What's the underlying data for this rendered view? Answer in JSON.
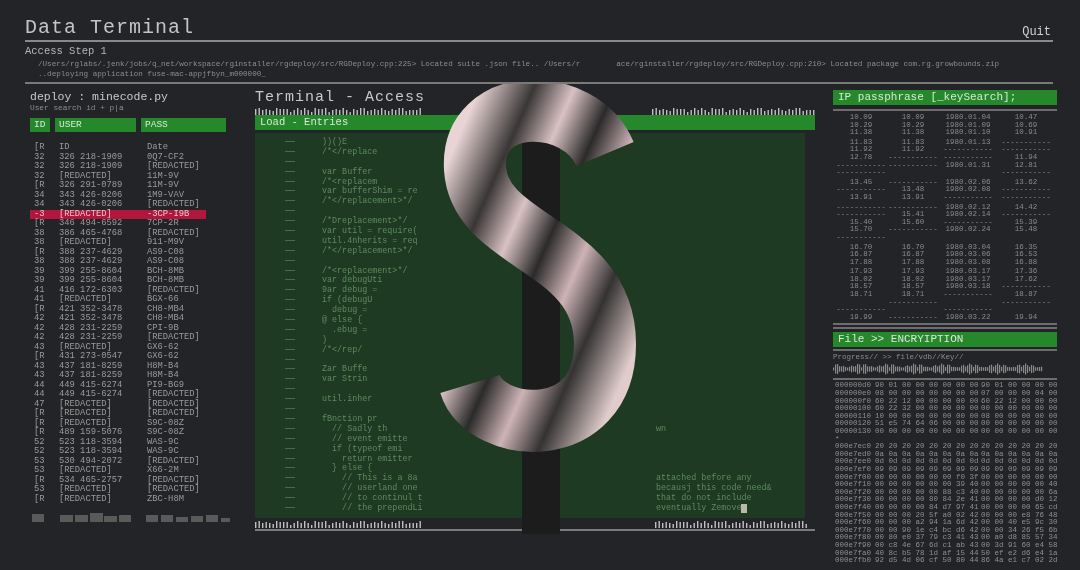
{
  "header": {
    "title": "Data Terminal",
    "quit": "Quit",
    "step": "Access Step 1",
    "log": [
      {
        "left": "/Users/rglabs/.jenk/jobs/q_net/workspace/rginstaller/rgdeploy/src/RGDeploy.cpp:225> Located suite .json file.. /Users/r",
        "right": "ace/rginstaller/rgdeploy/src/RGDeploy.cpp:210> Located package com.rg.growbounds.zip"
      },
      {
        "left": "..deploying application fuse-mac-appjfbyn_m000000_"
      }
    ]
  },
  "users": {
    "title": "deploy : minecode.py",
    "search": "User search id + p|a",
    "columns": [
      "ID",
      "USER",
      "PASS"
    ],
    "rows": [
      {
        "cells": [
          "[R",
          "ID",
          "Date"
        ],
        "selected": false
      },
      {
        "cells": [
          "32",
          "326 218-1909",
          "0Q7-CF2"
        ],
        "selected": false
      },
      {
        "cells": [
          "32",
          "326 218-1909",
          "[REDACTED]"
        ],
        "selected": false
      },
      {
        "cells": [
          "32",
          "[REDACTED]",
          "11M-9V"
        ],
        "selected": false
      },
      {
        "cells": [
          "[R",
          "326 291-0789",
          "11M-9V"
        ],
        "selected": false
      },
      {
        "cells": [
          "34",
          "343 426-0206",
          "1M9-VAV"
        ],
        "selected": false
      },
      {
        "cells": [
          "34",
          "343 426-0206",
          "[REDACTED]"
        ],
        "selected": false
      },
      {
        "cells": [
          "-3",
          "[REDACTED]",
          "-3CP-I9B"
        ],
        "selected": true
      },
      {
        "cells": [
          "[R",
          "346 494-6592",
          "7CP-2R"
        ],
        "selected": false
      },
      {
        "cells": [
          "38",
          "386 465-4768",
          "[REDACTED]"
        ],
        "selected": false
      },
      {
        "cells": [
          "38",
          "[REDACTED]",
          "911-M9V"
        ],
        "selected": false
      },
      {
        "cells": [
          "[R",
          "388 237-4629",
          "AS9-C08"
        ],
        "selected": false
      },
      {
        "cells": [
          "38",
          "388 237-4629",
          "AS9-C08"
        ],
        "selected": false
      },
      {
        "cells": [
          "39",
          "399 255-8604",
          "BCH-8MB"
        ],
        "selected": false
      },
      {
        "cells": [
          "39",
          "399 255-8604",
          "BCH-8MB"
        ],
        "selected": false
      },
      {
        "cells": [
          "41",
          "416 172-6303",
          "[REDACTED]"
        ],
        "selected": false
      },
      {
        "cells": [
          "41",
          "[REDACTED]",
          "BGX-66"
        ],
        "selected": false
      },
      {
        "cells": [
          "[R",
          "421 352-3478",
          "CH8-MB4"
        ],
        "selected": false
      },
      {
        "cells": [
          "42",
          "421 352-3478",
          "CH8-MB4"
        ],
        "selected": false
      },
      {
        "cells": [
          "42",
          "428 231-2259",
          "CPI-9B"
        ],
        "selected": false
      },
      {
        "cells": [
          "42",
          "428 231-2259",
          "[REDACTED]"
        ],
        "selected": false
      },
      {
        "cells": [
          "43",
          "[REDACTED]",
          "GX6-62"
        ],
        "selected": false
      },
      {
        "cells": [
          "[R",
          "431 273-0547",
          "GX6-62"
        ],
        "selected": false
      },
      {
        "cells": [
          "43",
          "437 181-8259",
          "H8M-B4"
        ],
        "selected": false
      },
      {
        "cells": [
          "43",
          "437 181-8259",
          "H8M-B4"
        ],
        "selected": false
      },
      {
        "cells": [
          "44",
          "449 415-6274",
          "PI9-BG9"
        ],
        "selected": false
      },
      {
        "cells": [
          "44",
          "449 415-6274",
          "[REDACTED]"
        ],
        "selected": false
      },
      {
        "cells": [
          "47",
          "[REDACTED]",
          "[REDACTED]"
        ],
        "selected": false
      },
      {
        "cells": [
          "[R",
          "[REDACTED]",
          "[REDACTED]"
        ],
        "selected": false
      },
      {
        "cells": [
          "[R",
          "[REDACTED]",
          "S9C-08Z"
        ],
        "selected": false
      },
      {
        "cells": [
          "[R",
          "489 159-5076",
          "S9C-08Z"
        ],
        "selected": false
      },
      {
        "cells": [
          "52",
          "523 118-3594",
          "WAS-9C"
        ],
        "selected": false
      },
      {
        "cells": [
          "52",
          "523 118-3594",
          "WAS-9C"
        ],
        "selected": false
      },
      {
        "cells": [
          "53",
          "530 494-2072",
          "[REDACTED]"
        ],
        "selected": false
      },
      {
        "cells": [
          "53",
          "[REDACTED]",
          "X66-2M"
        ],
        "selected": false
      },
      {
        "cells": [
          "[R",
          "534 465-2757",
          "[REDACTED]"
        ],
        "selected": false
      },
      {
        "cells": [
          "53",
          "[REDACTED]",
          "[REDACTED]"
        ],
        "selected": false
      },
      {
        "cells": [
          "[R",
          "[REDACTED]",
          "ZBC-H8M"
        ],
        "selected": false
      }
    ]
  },
  "terminal": {
    "title": "Terminal - Access",
    "bar": "Load - Entries",
    "cursor": true,
    "lines": [
      {
        "marker": "——",
        "text": "))()E"
      },
      {
        "marker": "——",
        "text": "/*</replace"
      },
      {
        "marker": "——"
      },
      {
        "marker": "——",
        "text": "var Buffer"
      },
      {
        "marker": "——",
        "text": "/*<replacem"
      },
      {
        "marker": "——",
        "text": "var bufferShim = re"
      },
      {
        "marker": "——",
        "text": "/*</replacement>*/"
      },
      {
        "marker": "——"
      },
      {
        "marker": "——",
        "text": "/*Dreplacement>*/"
      },
      {
        "marker": "——",
        "text": "var util = require("
      },
      {
        "marker": "——",
        "text": "util.4nherits = req"
      },
      {
        "marker": "——",
        "text": "/*</replacement>*/"
      },
      {
        "marker": "——"
      },
      {
        "marker": "——",
        "text": "/*<replacement>*/"
      },
      {
        "marker": "——",
        "text": "var debugUti"
      },
      {
        "marker": "——",
        "text": "9ar debug ="
      },
      {
        "marker": "——",
        "text": "if (debugU"
      },
      {
        "marker": "——",
        "text": "  debug ="
      },
      {
        "marker": "——",
        "text": "@ else {"
      },
      {
        "marker": "——",
        "text": "  .ebug ="
      },
      {
        "marker": "——",
        "text": ")"
      },
      {
        "marker": "——",
        "text": "/*</rep/"
      },
      {
        "marker": "——"
      },
      {
        "marker": "——",
        "text": "Zar Buffe"
      },
      {
        "marker": "——",
        "text": "var Strin"
      },
      {
        "marker": "——"
      },
      {
        "marker": "——",
        "text": "util.inher"
      },
      {
        "marker": "——"
      },
      {
        "marker": "——",
        "text": "fBnction pr"
      },
      {
        "marker": "——",
        "text": "  // Sadly th",
        "tail": "wn"
      },
      {
        "marker": "——",
        "text": "  // event emitte"
      },
      {
        "marker": "——",
        "text": "  if (typeof emi"
      },
      {
        "marker": "——",
        "text": "    return emitter"
      },
      {
        "marker": "——",
        "text": "  } else {"
      },
      {
        "marker": "——",
        "text": "    // This is a 8a",
        "tail": "attached before any"
      },
      {
        "marker": "——",
        "text": "    // userland one",
        "tail": "becausj this code need&"
      },
      {
        "marker": "——",
        "text": "    // to continul t",
        "tail": "that do not include"
      },
      {
        "marker": "——",
        "text": "    // the prependLi",
        "tail": "eventually Zemove"
      }
    ]
  },
  "passphrase": {
    "title": "IP passphrase [_keySearch];",
    "groups": [
      [
        {
          "c1": "10.09",
          "c2": "10.09",
          "c3": "1980.01.04",
          "c4": "10.47"
        },
        {
          "c1": "10.29",
          "c2": "10.29",
          "c3": "1980.01.09",
          "c4": "10.69"
        },
        {
          "c1": "11.38",
          "c2": "11.38",
          "c3": "1980.01.10",
          "c4": "10.91"
        }
      ],
      [
        {
          "c1": "11.83",
          "c2": "11.83",
          "c3": "1980.01.13",
          "c4": "-----------"
        },
        {
          "c1": "11.92",
          "c2": "11.92",
          "c3": "-----------",
          "c4": "-----------"
        },
        {
          "c1": "12.78",
          "c2": "-----------",
          "c3": "-----------",
          "c4": "11.94"
        },
        {
          "c1": "-----------",
          "c2": "-----------",
          "c3": "1980.01.31",
          "c4": "12.81"
        },
        {
          "c1": "-----------",
          "c4": "-----------"
        }
      ],
      [
        {
          "c1": "13.45",
          "c2": "-----------",
          "c3": "1980.02.06",
          "c4": "13.62"
        },
        {
          "c1": "-----------",
          "c2": "13.48",
          "c3": "1980.02.08",
          "c4": "-----------"
        },
        {
          "c1": "13.91",
          "c2": "13.91",
          "c3": "-----------",
          "c4": "-----------"
        }
      ],
      [
        {
          "c1": "-----------",
          "c2": "-----------",
          "c3": "1980.02.12",
          "c4": "14.42"
        },
        {
          "c1": "-----------",
          "c2": "15.41",
          "c3": "1980.02.14",
          "c4": "-----------"
        },
        {
          "c1": "15.40",
          "c2": "15.60",
          "c3": "-----------",
          "c4": "15.39"
        },
        {
          "c1": "15.70",
          "c2": "-----------",
          "c3": "1980.02.24",
          "c4": "15.48"
        },
        {
          "c1": "-----------"
        }
      ],
      [
        {
          "c1": "16.70",
          "c2": "16.70",
          "c3": "1980.03.04",
          "c4": "16.35"
        },
        {
          "c1": "16.87",
          "c2": "16.87",
          "c3": "1980.03.06",
          "c4": "16.53"
        },
        {
          "c1": "17.88",
          "c2": "17.88",
          "c3": "1980.03.08",
          "c4": "16.88"
        }
      ],
      [
        {
          "c1": "17.93",
          "c2": "17.93",
          "c3": "1980.03.17",
          "c4": "17.36"
        },
        {
          "c1": "18.02",
          "c2": "18.02",
          "c3": "1980.03.17",
          "c4": "17.62"
        },
        {
          "c1": "18.57",
          "c2": "18.57",
          "c3": "1980.03.18",
          "c4": "-----------"
        },
        {
          "c1": "18.71",
          "c2": "18.71",
          "c3": "-----------",
          "c4": "18.87"
        },
        {
          "c2": "-----------",
          "c4": "-----------"
        },
        {
          "c1": "-----------",
          "c3": "-----------"
        },
        {
          "c1": "19.99",
          "c2": "-----------",
          "c3": "1980.03.22",
          "c4": "19.94"
        }
      ]
    ]
  },
  "encryption": {
    "title": "File >> ENCRYIPTION",
    "progress": "Progress// >> file/vdb//Key//",
    "dump": [
      {
        "kind": "row",
        "addr": "000000d0",
        "a": "90 01 00 00 00 00 00 00",
        "b": "90 01 00 00 00 00"
      },
      {
        "kind": "row",
        "addr": "000000e0",
        "a": "08 00 00 00 00 00 00 00",
        "b": "07 00 00 00 04 00"
      },
      {
        "kind": "row",
        "addr": "000000f0",
        "a": "60 22 12 00 00 00 00 00",
        "b": "60 22 12 00 00 00"
      },
      {
        "kind": "row",
        "addr": "00000100",
        "a": "60 22 32 00 00 00 00 00",
        "b": "00 00 00 00 00 00"
      },
      {
        "kind": "row",
        "addr": "00000110",
        "a": "10 00 00 00 00 00 00 00",
        "b": "08 00 00 00 00 00"
      },
      {
        "kind": "row",
        "addr": "00000120",
        "a": "51 e5 74 64 06 00 00 00",
        "b": "00 00 00 00 00 00"
      },
      {
        "kind": "row",
        "addr": "00000130",
        "a": "00 00 00 00 00 00 00 00",
        "b": "00 00 00 00 00 00"
      },
      {
        "kind": "skip",
        "text": "*"
      },
      {
        "kind": "row",
        "addr": "000e7ec0",
        "a": "20 20 20 20 20 20 20 20",
        "b": "20 20 20 20 20 20"
      },
      {
        "kind": "row",
        "addr": "000e7ed0",
        "a": "0a 0a 0a 0a 0a 0a 0a 0a",
        "b": "0a 0a 0a 0a 0a 0a"
      },
      {
        "kind": "row",
        "addr": "000e7ee0",
        "a": "0d 0d 0d 0d 0d 0d 0d 0d",
        "b": "0d 0d 0d 0d 0d 0d"
      },
      {
        "kind": "row",
        "addr": "000e7ef0",
        "a": "09 09 09 09 09 09 09 09",
        "b": "09 09 09 09 09 09"
      },
      {
        "kind": "row",
        "addr": "000e7f00",
        "a": "00 00 00 00 00 00 f0 3f",
        "b": "00 00 00 00 00 00"
      },
      {
        "kind": "row",
        "addr": "000e7f10",
        "a": "00 00 00 00 00 00 39 40",
        "b": "00 00 00 00 00 40"
      },
      {
        "kind": "row",
        "addr": "000e7f20",
        "a": "00 00 00 00 00 88 c3 40",
        "b": "00 00 00 00 00 6a"
      },
      {
        "kind": "row",
        "addr": "000e7f30",
        "a": "00 00 00 00 80 84 2e 41",
        "b": "00 00 00 00 d0 12"
      },
      {
        "kind": "row",
        "addr": "000e7f40",
        "a": "00 00 00 00 84 d7 97 41",
        "b": "00 00 00 00 65 cd"
      },
      {
        "kind": "row",
        "addr": "000e7f50",
        "a": "00 00 00 20 5f a0 02 42",
        "b": "00 00 00 e8 76 48"
      },
      {
        "kind": "row",
        "addr": "000e7f60",
        "a": "00 00 00 a2 94 1a 6d 42",
        "b": "00 00 40 e5 9c 30"
      },
      {
        "kind": "row",
        "addr": "000e7f70",
        "a": "00 00 90 1e c4 bc d6 42",
        "b": "00 00 34 26 f5 6b"
      },
      {
        "kind": "row",
        "addr": "000e7f80",
        "a": "00 80 e0 37 79 c3 41 43",
        "b": "00 a0 d8 85 57 34"
      },
      {
        "kind": "row",
        "addr": "000e7f90",
        "a": "00 c8 4e 67 6d c1 ab 43",
        "b": "00 3d 91 60 e4 58"
      },
      {
        "kind": "row",
        "addr": "000e7fa0",
        "a": "40 8c b5 78 1d af 15 44",
        "b": "50 ef e2 d6 e4 1a"
      },
      {
        "kind": "row",
        "addr": "000e7fb0",
        "a": "92 d5 4d 06 cf 50 80 44",
        "b": "86 4a e1 c7 02 2d"
      }
    ]
  }
}
